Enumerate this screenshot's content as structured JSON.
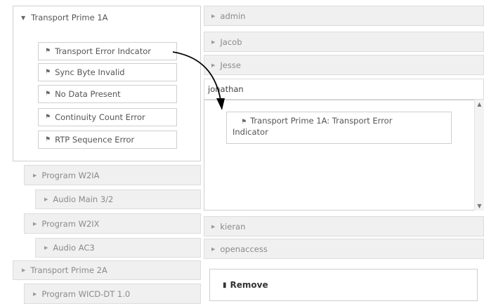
{
  "left_tree": {
    "transport1": {
      "label": "Transport Prime 1A",
      "alarms": [
        "Transport Error Indcator",
        "Sync Byte Invalid",
        "No Data Present",
        "Continuity Count Error",
        "RTP Sequence Error"
      ]
    },
    "program_w21a": "Program W2IA",
    "audio_main": "Audio Main 3/2",
    "program_w21x": "Program W2IX",
    "audio_ac3": "Audio AC3",
    "transport2": "Transport Prime 2A",
    "program_wicd": "Program WICD-DT 1.0"
  },
  "right_users": {
    "admin": "admin",
    "jacob": "Jacob",
    "jesse": "Jesse",
    "jonathan": "jonathan",
    "assigned_alarm_line1": "Transport Prime 1A: Transport Error",
    "assigned_alarm_line2": "Indicator",
    "kieran": "kieran",
    "openaccess": "openaccess"
  },
  "remove_button": {
    "label": "Remove"
  },
  "icons": {
    "alarm": "alarm-icon",
    "trash": "trash-icon",
    "expand": "expand-arrow-icon",
    "collapse": "collapse-arrow-icon"
  },
  "colors": {
    "panel_bg": "#f0f0f0",
    "border": "#cfcfcf",
    "text": "#555555"
  }
}
